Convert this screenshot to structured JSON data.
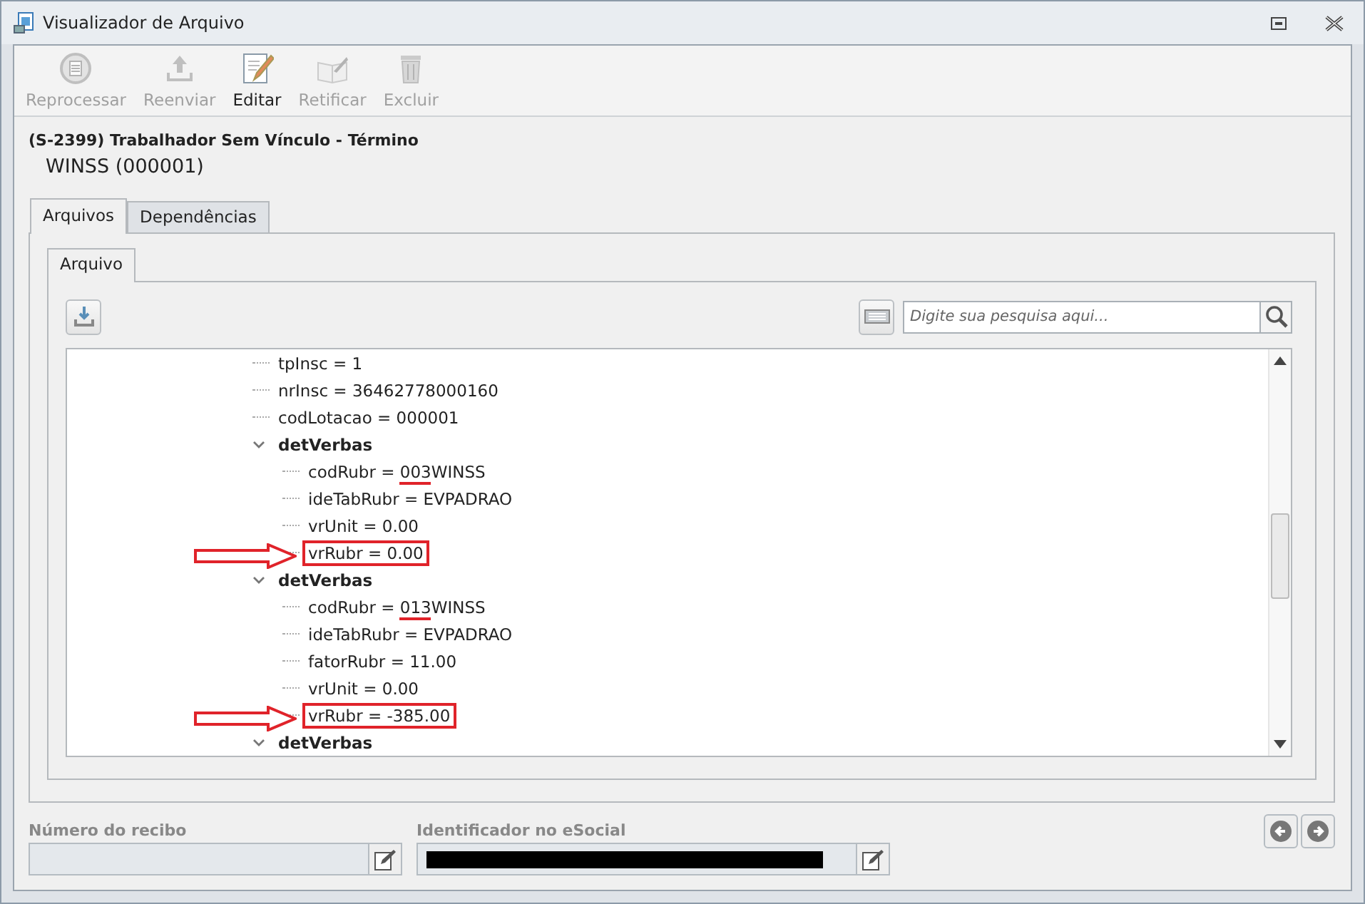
{
  "window": {
    "title": "Visualizador de Arquivo"
  },
  "toolbar": [
    {
      "label": "Reprocessar",
      "kind": "reprocess",
      "disabled": true
    },
    {
      "label": "Reenviar",
      "kind": "upload",
      "disabled": true
    },
    {
      "label": "Editar",
      "kind": "edit",
      "disabled": false
    },
    {
      "label": "Retificar",
      "kind": "rectify",
      "disabled": true
    },
    {
      "label": "Excluir",
      "kind": "delete",
      "disabled": true
    }
  ],
  "header": {
    "title": "(S-2399) Trabalhador Sem Vínculo - Término",
    "subtitle": "WINSS (000001)"
  },
  "tabs": [
    {
      "label": "Arquivos",
      "selected": true
    },
    {
      "label": "Dependências",
      "selected": false
    }
  ],
  "subtabs": [
    {
      "label": "Arquivo",
      "selected": true
    }
  ],
  "search": {
    "placeholder": "Digite sua pesquisa aqui..."
  },
  "tree": [
    {
      "label": "tpInsc = 1",
      "highlighted": false
    },
    {
      "label": "nrInsc = 36462778000160",
      "highlighted": false
    },
    {
      "label": "codLotacao = 000001",
      "highlighted": false
    },
    {
      "label": "detVerbas",
      "expanded": true,
      "children": [
        {
          "label": "codRubr = ",
          "underlined": "003",
          "rest": "WINSS",
          "highlighted": false
        },
        {
          "label": "ideTabRubr = EVPADRAO",
          "highlighted": false
        },
        {
          "label": "vrUnit = 0.00",
          "highlighted": false
        },
        {
          "label": "vrRubr = 0.00",
          "highlighted": true
        }
      ]
    },
    {
      "label": "detVerbas",
      "expanded": true,
      "children": [
        {
          "label": "codRubr = ",
          "underlined": "013",
          "rest": "WINSS",
          "highlighted": false
        },
        {
          "label": "ideTabRubr = EVPADRAO",
          "highlighted": false
        },
        {
          "label": "fatorRubr = 11.00",
          "highlighted": false
        },
        {
          "label": "vrUnit = 0.00",
          "highlighted": false
        },
        {
          "label": "vrRubr = -385.00",
          "highlighted": true
        }
      ]
    },
    {
      "label": "detVerbas",
      "expanded": true
    }
  ],
  "footer": {
    "fields": [
      {
        "label": "Número do recibo",
        "redacted": false
      },
      {
        "label": "Identificador no eSocial",
        "redacted": true
      }
    ]
  }
}
